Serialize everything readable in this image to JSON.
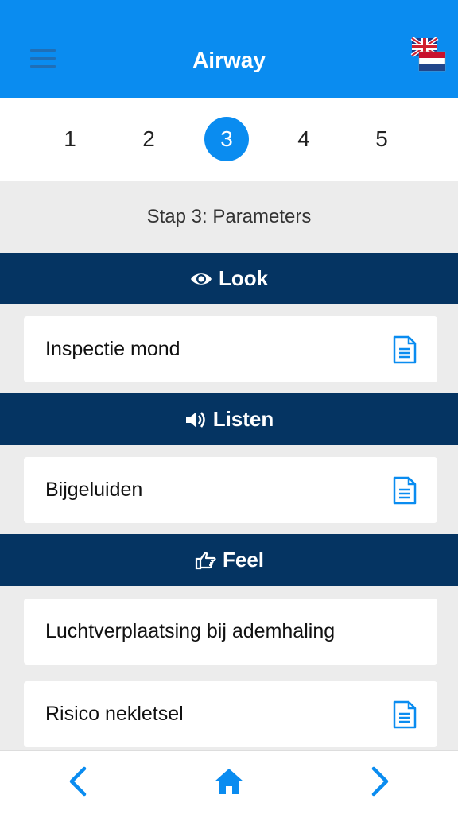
{
  "header": {
    "title": "Airway",
    "menu_icon": "hamburger-menu-icon",
    "language_icon": "language-flags-icon"
  },
  "stepper": {
    "steps": [
      "1",
      "2",
      "3",
      "4",
      "5"
    ],
    "active": "3",
    "accent": "#0a8cf0"
  },
  "page": {
    "subtitle": "Stap 3: Parameters"
  },
  "sections": [
    {
      "title": "Look",
      "icon": "eye-icon",
      "items": [
        {
          "label": "Inspectie mond",
          "has_doc": true
        }
      ]
    },
    {
      "title": "Listen",
      "icon": "speaker-icon",
      "items": [
        {
          "label": "Bijgeluiden",
          "has_doc": true
        }
      ]
    },
    {
      "title": "Feel",
      "icon": "hand-pointer-icon",
      "items": [
        {
          "label": "Luchtverplaatsing bij ademhaling",
          "has_doc": false
        },
        {
          "label": "Risico nekletsel",
          "has_doc": true
        }
      ]
    }
  ],
  "footer": {
    "back_icon": "chevron-left-icon",
    "home_icon": "home-icon",
    "next_icon": "chevron-right-icon"
  },
  "colors": {
    "header_bg": "#0a8cf0",
    "section_bg": "#053462",
    "page_bg": "#ececec",
    "icon_blue": "#0a8cf0"
  }
}
